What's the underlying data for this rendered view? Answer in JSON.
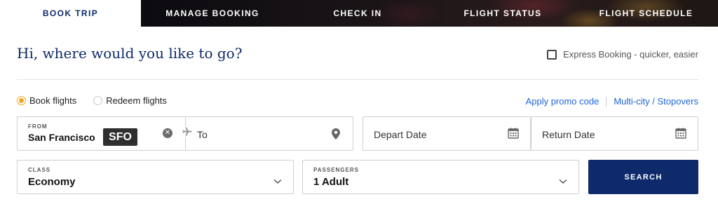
{
  "tabs": {
    "book_trip": "BOOK TRIP",
    "manage_booking": "MANAGE BOOKING",
    "check_in": "CHECK IN",
    "flight_status": "FLIGHT STATUS",
    "flight_schedule": "FLIGHT SCHEDULE",
    "active": "book_trip"
  },
  "heading": "Hi, where would you like to go?",
  "express_booking": {
    "label": "Express Booking - quicker, easier",
    "checked": false
  },
  "trip_type": {
    "options": [
      "Book flights",
      "Redeem flights"
    ],
    "selected": "Book flights"
  },
  "links": {
    "promo": "Apply promo code",
    "multicity": "Multi-city / Stopovers"
  },
  "from": {
    "label": "FROM",
    "city": "San Francisco",
    "code": "SFO"
  },
  "to": {
    "placeholder": "To"
  },
  "dates": {
    "depart": "Depart Date",
    "return": "Return Date"
  },
  "class": {
    "label": "CLASS",
    "value": "Economy"
  },
  "passengers": {
    "label": "PASSENGERS",
    "value": "1 Adult"
  },
  "search_label": "SEARCH",
  "icons": {
    "clear": "close-circle-icon",
    "plane": "plane-icon",
    "pin": "location-pin-icon",
    "calendar": "calendar-icon",
    "chevron": "chevron-down-icon"
  },
  "colors": {
    "brand_navy": "#0e2a6b",
    "link_blue": "#1d64d8",
    "radio_orange": "#f7a41d"
  }
}
